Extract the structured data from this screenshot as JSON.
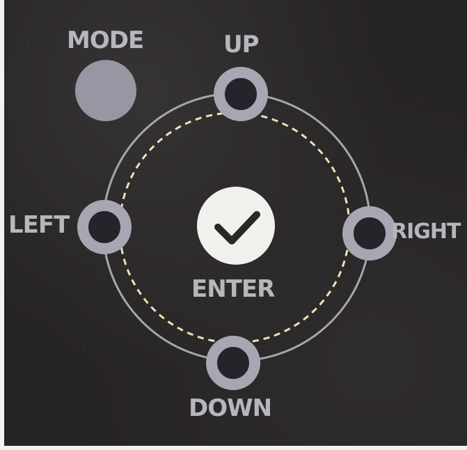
{
  "labels": {
    "mode": "MODE",
    "up": "UP",
    "left": "LEFT",
    "right": "RIGHT",
    "enter": "ENTER",
    "down": "DOWN"
  },
  "colors": {
    "panel": "#262324",
    "label": "#b8b6bd",
    "button": "#a8a6b2",
    "enter_button": "#f1f0ec",
    "dashed_ring": "#e8e6b8"
  },
  "icons": {
    "enter": "checkmark-icon",
    "directions": "ring-button"
  }
}
